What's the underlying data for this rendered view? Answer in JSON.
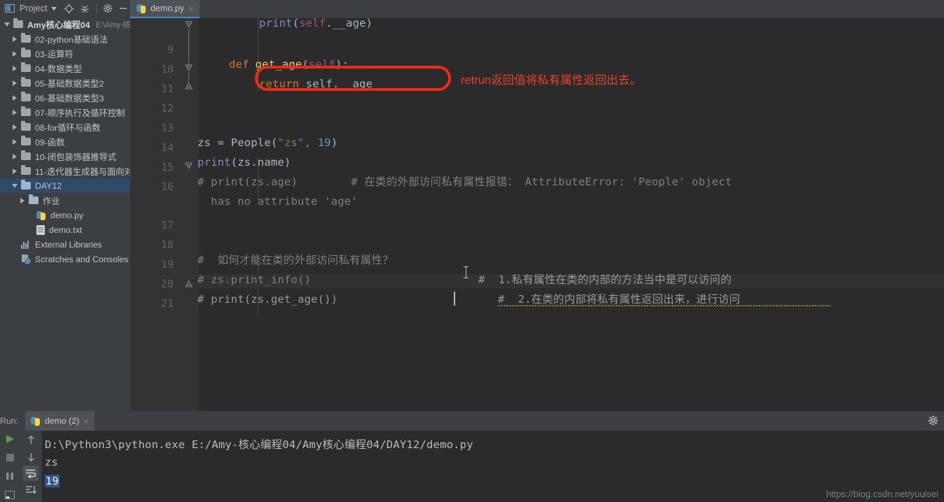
{
  "toolbar": {
    "project_label": "Project",
    "icons": [
      "locate-icon",
      "collapse-all-icon",
      "settings-icon",
      "minimize-icon"
    ]
  },
  "editor_tabs": [
    {
      "label": "demo.py",
      "icon": "python-file-icon",
      "close": "×",
      "active": true
    }
  ],
  "sidebar": {
    "items": [
      {
        "label": "Amy核心编程04",
        "sub": "E:\\Amy-核",
        "depth": 0,
        "icon": "folder-icon",
        "arrow": "expanded",
        "bold": true,
        "selected": false
      },
      {
        "label": "02-python基础语法",
        "sub": "",
        "depth": 1,
        "icon": "folder-icon",
        "arrow": "collapsed",
        "bold": false,
        "selected": false
      },
      {
        "label": "03-运算符",
        "sub": "",
        "depth": 1,
        "icon": "folder-icon",
        "arrow": "collapsed",
        "bold": false,
        "selected": false
      },
      {
        "label": "04-数据类型",
        "sub": "",
        "depth": 1,
        "icon": "folder-icon",
        "arrow": "collapsed",
        "bold": false,
        "selected": false
      },
      {
        "label": "05-基础数据类型2",
        "sub": "",
        "depth": 1,
        "icon": "folder-icon",
        "arrow": "collapsed",
        "bold": false,
        "selected": false
      },
      {
        "label": "06-基础数据类型3",
        "sub": "",
        "depth": 1,
        "icon": "folder-icon",
        "arrow": "collapsed",
        "bold": false,
        "selected": false
      },
      {
        "label": "07-顺序执行及循环控制",
        "sub": "",
        "depth": 1,
        "icon": "folder-icon",
        "arrow": "collapsed",
        "bold": false,
        "selected": false
      },
      {
        "label": "08-for循环与函数",
        "sub": "",
        "depth": 1,
        "icon": "folder-icon",
        "arrow": "collapsed",
        "bold": false,
        "selected": false
      },
      {
        "label": "09-函数",
        "sub": "",
        "depth": 1,
        "icon": "folder-icon",
        "arrow": "collapsed",
        "bold": false,
        "selected": false
      },
      {
        "label": "10-闭包装饰器推导式",
        "sub": "",
        "depth": 1,
        "icon": "folder-icon",
        "arrow": "collapsed",
        "bold": false,
        "selected": false
      },
      {
        "label": "11-迭代器生成器与面向对",
        "sub": "",
        "depth": 1,
        "icon": "folder-icon",
        "arrow": "collapsed",
        "bold": false,
        "selected": false
      },
      {
        "label": "DAY12",
        "sub": "",
        "depth": 1,
        "icon": "folder-module-icon",
        "arrow": "expanded",
        "bold": false,
        "selected": true
      },
      {
        "label": "作业",
        "sub": "",
        "depth": 2,
        "icon": "folder-module-icon",
        "arrow": "collapsed",
        "bold": false,
        "selected": false
      },
      {
        "label": "demo.py",
        "sub": "",
        "depth": 3,
        "icon": "python-file-icon",
        "arrow": "none",
        "bold": false,
        "selected": false
      },
      {
        "label": "demo.txt",
        "sub": "",
        "depth": 3,
        "icon": "text-file-icon",
        "arrow": "none",
        "bold": false,
        "selected": false
      },
      {
        "label": "External Libraries",
        "sub": "",
        "depth": 1,
        "icon": "libraries-icon",
        "arrow": "none",
        "bold": false,
        "selected": false
      },
      {
        "label": "Scratches and Consoles",
        "sub": "",
        "depth": 1,
        "icon": "scratches-icon",
        "arrow": "none",
        "bold": false,
        "selected": false
      }
    ]
  },
  "code": {
    "line_numbers": [
      "9",
      "10",
      "11",
      "12",
      "13",
      "14",
      "15",
      "16",
      "17",
      "18",
      "19",
      "20",
      "21"
    ],
    "lines": [
      {
        "n": "",
        "text": "        print(self.__age)"
      },
      {
        "n": "9",
        "text": ""
      },
      {
        "n": "10",
        "text": "    def get_age(self):"
      },
      {
        "n": "11",
        "text": "        return self.__age"
      },
      {
        "n": "12",
        "text": ""
      },
      {
        "n": "13",
        "text": ""
      },
      {
        "n": "14",
        "text": "zs = People(\"zs\", 19)"
      },
      {
        "n": "15",
        "text": "print(zs.name)"
      },
      {
        "n": "16",
        "text": "# print(zs.age)        # 在类的外部访问私有属性报错： AttributeError: 'People' object has no attribute 'age'"
      },
      {
        "n": "17",
        "text": ""
      },
      {
        "n": "18",
        "text": ""
      },
      {
        "n": "19",
        "text": "# 如何才能在类的外部访问私有属性？"
      },
      {
        "n": "20",
        "text": "# zs.print_info()       # 1.私有属性在类的内部的方法当中是可以访问的"
      },
      {
        "n": "21",
        "text": "# print(zs.get_age())       # 2.在类的内部将私有属性返回出来，进行访问"
      }
    ],
    "tokens": {
      "l8_print": "print",
      "l8_open": "(",
      "l8_self": "self",
      "l8_age": ".__age)",
      "l10_def": "def",
      "l10_name": "get_age",
      "l10_open": "(",
      "l10_self": "self",
      "l10_close": "):",
      "l11_return": "return",
      "l11_rest": " self.__age",
      "l14_zs": "zs = ",
      "l14_people": "People",
      "l14_paren1": "(",
      "l14_str": "\"zs\"",
      "l14_comma": ",",
      "l14_num": " 19",
      "l14_paren2": ")",
      "l15_print": "print",
      "l15_rest": "(zs.name)",
      "l16_a": "# print(zs.age)        # 在类的外部访问私有属性报错： AttributeError: 'People' object",
      "l16_b": "  has no attribute 'age'",
      "l19": "#  如何才能在类的外部访问私有属性？",
      "l20_a": "# zs.print_info()",
      "l20_b": "#  1.私有属性在类的内部的方法当中是可以访问的",
      "l21_a": "# print(zs.get_age())",
      "l21_b": "#  2.在类的内部将私有属性返回出来，进行访问"
    }
  },
  "annotation": {
    "text": "retrun返回值将私有属性返回出去。",
    "color": "#ee2b17"
  },
  "run_panel": {
    "label": "Run:",
    "tab_label": "demo (2)",
    "tab_icon": "python-file-icon",
    "tab_close": "×",
    "gear": "settings-icon",
    "console": {
      "command": "D:\\Python3\\python.exe E:/Amy-核心编程04/Amy核心编程04/DAY12/demo.py",
      "output_1": "zs",
      "output_2": "19"
    },
    "side_buttons": [
      "run-icon",
      "stop-icon",
      "pause-icon",
      "scroll-icon"
    ],
    "toolbar_buttons": [
      "up-arrow-icon",
      "down-arrow-icon",
      "soft-wrap-icon",
      "scroll-to-end-icon"
    ]
  },
  "watermark": "https://blog.csdn.net/yuuisei",
  "colors": {
    "accent": "#4a88c7",
    "annotation": "#ee2b17",
    "editor_bg": "#2b2b2b",
    "panel_bg": "#3c3f41",
    "selection": "#2f4a69",
    "console_selection": "#2f5699"
  }
}
